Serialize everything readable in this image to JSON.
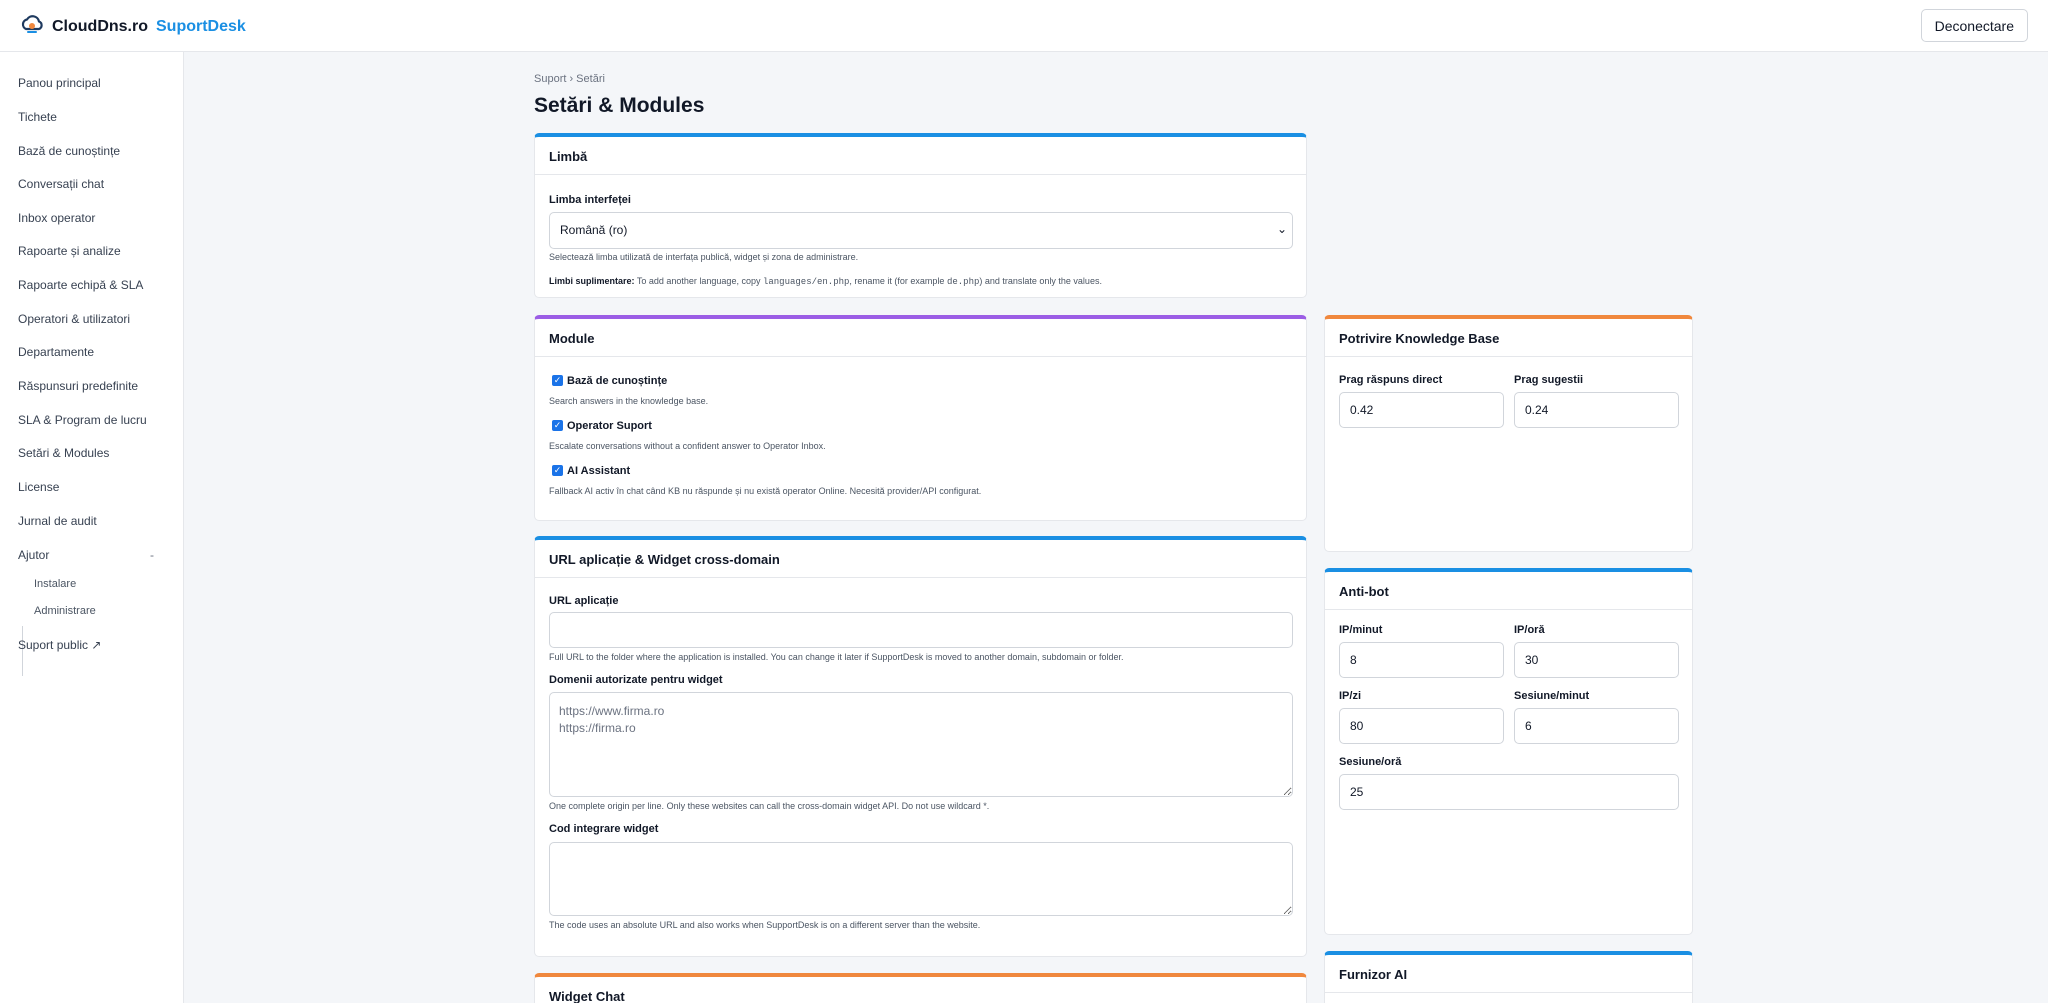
{
  "brand": {
    "name": "CloudDns.ro",
    "accent": "SuportDesk",
    "logo_icon": "cloud-icon"
  },
  "header": {
    "logout_label": "Deconectare"
  },
  "sidebar": {
    "items": [
      {
        "label": "Panou principal"
      },
      {
        "label": "Tichete"
      },
      {
        "label": "Bază de cunoștințe"
      },
      {
        "label": "Conversații chat"
      },
      {
        "label": "Inbox operator"
      },
      {
        "label": "Rapoarte și analize"
      },
      {
        "label": "Rapoarte echipă & SLA"
      },
      {
        "label": "Operatori & utilizatori"
      },
      {
        "label": "Departamente"
      },
      {
        "label": "Răspunsuri predefinite"
      },
      {
        "label": "SLA & Program de lucru"
      },
      {
        "label": "Setări & Modules"
      },
      {
        "label": "License"
      },
      {
        "label": "Jurnal de audit"
      }
    ],
    "help": {
      "label": "Ajutor",
      "toggle": "-",
      "children": [
        {
          "label": "Instalare"
        },
        {
          "label": "Administrare"
        }
      ]
    },
    "public_support": "Suport public ↗"
  },
  "breadcrumb": "Suport › Setări",
  "page_title": "Setări & Modules",
  "language": {
    "title": "Limbă",
    "field_label": "Limba interfeței",
    "selected": "Română (ro)",
    "help": "Selectează limba utilizată de interfața publică, widget și zona de administrare.",
    "extra_label": "Limbi suplimentare:",
    "extra_1": "To add another language, copy",
    "extra_code_1": "languages/en.php",
    "extra_2": ", rename it (for example",
    "extra_code_2": "de.php",
    "extra_3": ") and translate only the values."
  },
  "modules": {
    "title": "Module",
    "items": [
      {
        "label": "Bază de cunoștințe",
        "desc": "Search answers in the knowledge base.",
        "checked": true
      },
      {
        "label": "Operator Suport",
        "desc": "Escalate conversations without a confident answer to Operator Inbox.",
        "checked": true
      },
      {
        "label": "AI Assistant",
        "desc": "Fallback AI activ în chat când KB nu răspunde și nu există operator Online. Necesită provider/API configurat.",
        "checked": true
      }
    ]
  },
  "kb_match": {
    "title": "Potrivire Knowledge Base",
    "direct_label": "Prag răspuns direct",
    "direct_value": "0.42",
    "suggest_label": "Prag sugestii",
    "suggest_value": "0.24"
  },
  "app_url": {
    "title": "URL aplicație & Widget cross-domain",
    "url_label": "URL aplicație",
    "url_value": "",
    "url_help": "Full URL to the folder where the application is installed. You can change it later if SupportDesk is moved to another domain, subdomain or folder.",
    "domains_label": "Domenii autorizate pentru widget",
    "domains_placeholder": "https://www.firma.ro\nhttps://firma.ro",
    "domains_help": "One complete origin per line. Only these websites can call the cross-domain widget API. Do not use wildcard *.",
    "embed_label": "Cod integrare widget",
    "embed_value": "",
    "embed_help": "The code uses an absolute URL and also works when SupportDesk is on a different server than the website."
  },
  "antibot": {
    "title": "Anti-bot",
    "ip_min_label": "IP/minut",
    "ip_min_value": "8",
    "ip_hour_label": "IP/oră",
    "ip_hour_value": "30",
    "ip_day_label": "IP/zi",
    "ip_day_value": "80",
    "sess_min_label": "Sesiune/minut",
    "sess_min_value": "6",
    "sess_hour_label": "Sesiune/oră",
    "sess_hour_value": "25"
  },
  "widget_chat": {
    "title": "Widget Chat"
  },
  "ai_provider": {
    "title": "Furnizor AI"
  },
  "colors": {
    "accent": "#1a8fe3",
    "purple": "#9b5de5",
    "orange": "#f0883e"
  }
}
